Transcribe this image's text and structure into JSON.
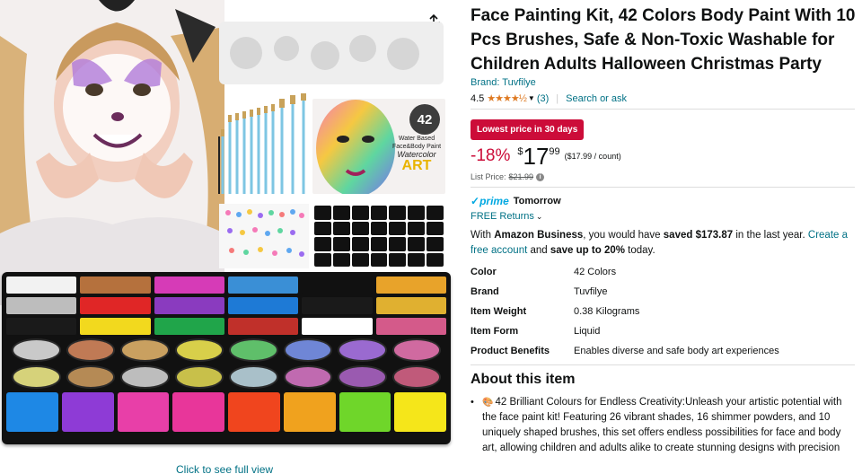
{
  "product": {
    "title": "Face Painting Kit, 42 Colors Body Paint With 10 Pcs Brushes, Safe & Non-Toxic Washable for Children Adults Halloween Christmas Party",
    "brand_link": "Brand: Tuvfilye",
    "rating_value": "4.5",
    "rating_stars": "★★★★½",
    "rating_count": "(3)",
    "search_ask": "Search or ask"
  },
  "gallery": {
    "see_full_view": "Click to see full view",
    "art_badge": "42",
    "art_line1": "Water Based",
    "art_line2": "Face&Body Paint",
    "art_line3": "Watercolor",
    "art_line4": "ART",
    "share_icon": "share-icon"
  },
  "deal": {
    "badge": "Lowest price in 30 days",
    "discount": "-18%",
    "currency": "$",
    "whole": "17",
    "fraction": "99",
    "per_unit": "($17.99 / count)",
    "list_price_label": "List Price:",
    "list_price": "$21.99"
  },
  "delivery": {
    "prime_check": "✓",
    "prime_word": "prime",
    "prime_day": "Tomorrow",
    "returns": "FREE Returns"
  },
  "business": {
    "p1": "With ",
    "p2": "Amazon Business",
    "p3": ", you would have ",
    "p4": "saved $173.87",
    "p5": " in the last year. ",
    "p6": "Create a free account",
    "p7": " and ",
    "p8": "save up to 20%",
    "p9": " today."
  },
  "specs": [
    {
      "key": "Color",
      "value": "42 Colors"
    },
    {
      "key": "Brand",
      "value": "Tuvfilye"
    },
    {
      "key": "Item Weight",
      "value": "0.38 Kilograms"
    },
    {
      "key": "Item Form",
      "value": "Liquid"
    },
    {
      "key": "Product Benefits",
      "value": "Enables diverse and safe body art experiences"
    }
  ],
  "about": {
    "heading": "About this item",
    "items": [
      "42 Brilliant Colours for Endless Creativity:Unleash your artistic potential with the face paint kit! Featuring 26 vibrant shades, 16 shimmer powders, and 10 uniquely shaped brushes, this set offers endless possibilities for face and body art, allowing children and adults alike to create stunning designs with precision"
    ]
  },
  "colors": {
    "link": "#007185",
    "deal_red": "#CC0C39",
    "star": "#DE7921",
    "prime": "#00A8E1"
  }
}
